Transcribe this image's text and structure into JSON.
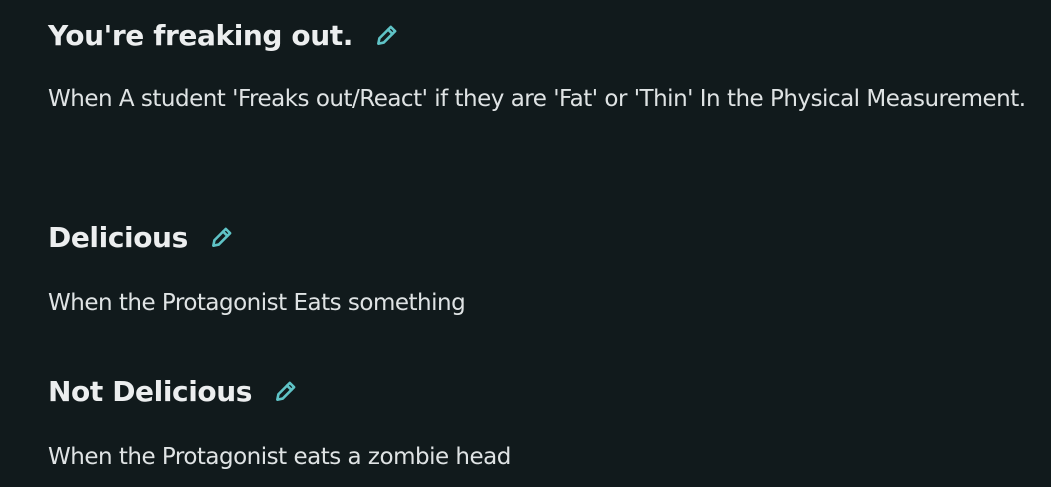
{
  "colors": {
    "background": "#111a1c",
    "title": "#eceeef",
    "text": "#dfe3e4",
    "accent": "#5fc3c6"
  },
  "entries": [
    {
      "title": "You're freaking out.",
      "edit_icon": "pencil-icon",
      "description": "When A student 'Freaks out/React' if they are 'Fat' or 'Thin' In the Physical Measurement."
    },
    {
      "title": "Delicious",
      "edit_icon": "pencil-icon",
      "description": "When the Protagonist Eats something"
    },
    {
      "title": "Not Delicious",
      "edit_icon": "pencil-icon",
      "description": "When the Protagonist eats a zombie head"
    }
  ]
}
